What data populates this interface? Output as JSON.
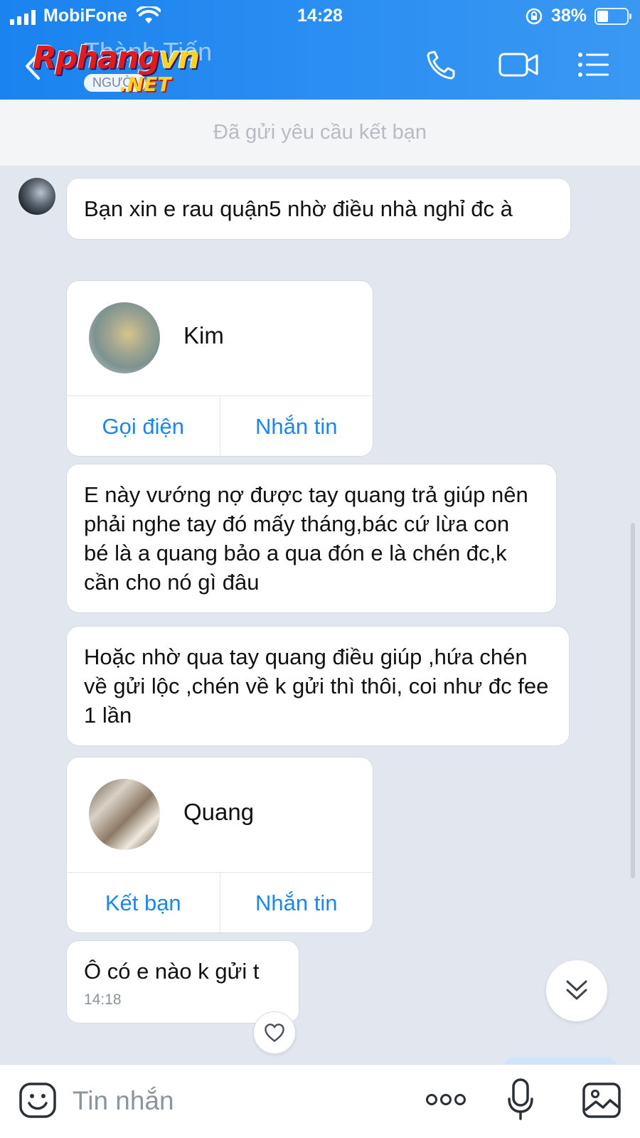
{
  "status_bar": {
    "carrier": "MobiFone",
    "time": "14:28",
    "battery_percent_text": "38%",
    "battery_level": 0.38
  },
  "header": {
    "contact_name": "Thành Tiến",
    "contact_sub": "NGƯỜI",
    "watermark_main": "Rphang",
    "watermark_accent": "vn",
    "watermark_sub": ".NET",
    "icons": [
      "back-icon",
      "phone-icon",
      "video-call-icon",
      "menu-icon"
    ]
  },
  "friend_request_banner": "Đã gửi yêu cầu kết bạn",
  "messages": {
    "m1": "Bạn xin e rau quận5 nhờ điều nhà nghỉ đc à",
    "card1": {
      "name": "Kim",
      "action_left": "Gọi điện",
      "action_right": "Nhắn tin"
    },
    "m2": "E này vướng nợ được tay quang trả giúp nên phải nghe tay đó mấy tháng,bác cứ lừa con bé là a quang bảo a qua đón e là chén đc,k cần cho nó gì đâu",
    "m3": "Hoặc nhờ qua tay quang điều giúp ,hứa chén về gửi lộc ,chén về k gửi thì thôi, coi như đc fee 1 lần",
    "card2": {
      "name": "Quang",
      "action_left": "Kết bạn",
      "action_right": "Nhắn tin"
    },
    "m4": "Ô có e nào k gửi t",
    "m4_time": "14:18"
  },
  "input_bar": {
    "placeholder": "Tin nhắn",
    "icons": [
      "emoji-icon",
      "more-icon",
      "microphone-icon",
      "image-icon"
    ]
  },
  "colors": {
    "header_blue": "#1a83ef",
    "action_blue": "#1c86f0",
    "chat_background": "#e2e7ef"
  }
}
